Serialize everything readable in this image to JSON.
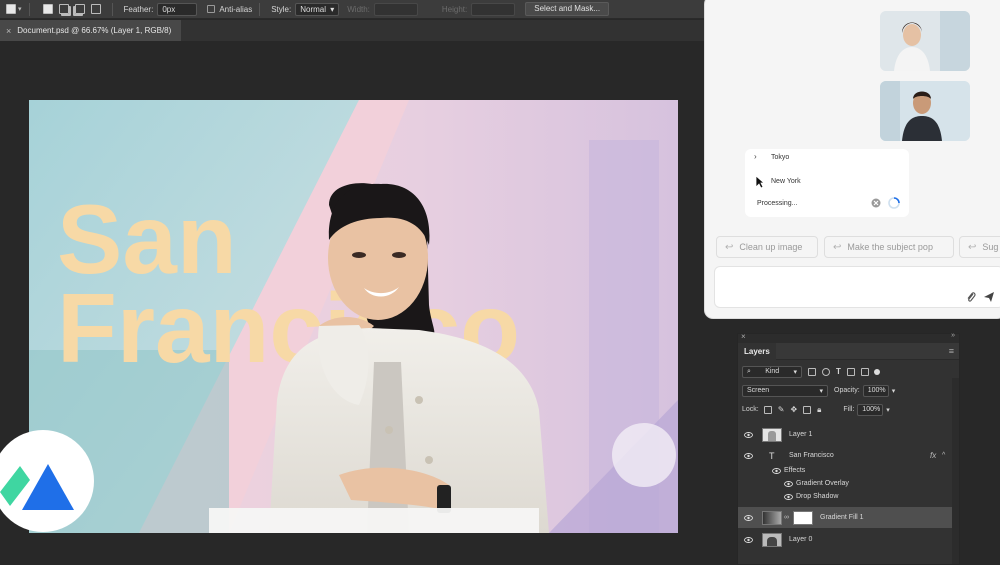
{
  "options_bar": {
    "feather_label": "Feather:",
    "feather_value": "0px",
    "antialias_label": "Anti-alias",
    "style_label": "Style:",
    "style_value": "Normal",
    "width_label": "Width:",
    "height_label": "Height:",
    "select_mask_label": "Select and Mask..."
  },
  "document_tab": {
    "title": "Document.psd @ 66.67% (Layer 1, RGB/8)"
  },
  "canvas": {
    "line1": "San",
    "line2": "Francisco",
    "text_color": "#f7d9a6"
  },
  "assistant": {
    "locations": [
      "Tokyo",
      "New York"
    ],
    "status": "Processing...",
    "suggestions": [
      "Clean up image",
      "Make the subject pop",
      "Sug"
    ]
  },
  "layers_panel": {
    "title": "Layers",
    "filter_kind": "Kind",
    "blend_mode": "Screen",
    "opacity_label": "Opacity:",
    "opacity_value": "100%",
    "lock_label": "Lock:",
    "fill_label": "Fill:",
    "fill_value": "100%",
    "layers": [
      {
        "name": "Layer 1"
      },
      {
        "name": "San Francisco",
        "fx": "fx"
      },
      {
        "name": "Effects"
      },
      {
        "name": "Gradient Overlay"
      },
      {
        "name": "Drop Shadow"
      },
      {
        "name": "Gradient Fill 1",
        "selected": true
      },
      {
        "name": "Layer 0"
      }
    ]
  },
  "colors": {
    "accent_blue": "#1f6fe8",
    "accent_green": "#3fd6a1",
    "selected_layer": "#4f4f4f"
  }
}
